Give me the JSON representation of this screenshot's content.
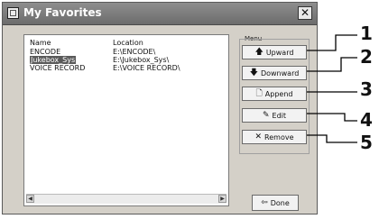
{
  "window": {
    "title": "My Favorites",
    "close_symbol": "✕"
  },
  "list": {
    "columns": [
      "Name",
      "Location"
    ],
    "rows": [
      {
        "name": "ENCODE",
        "location": "E:\\ENCODE\\"
      },
      {
        "name": "Jukebox_Sys",
        "location": "E:\\Jukebox_Sys\\"
      },
      {
        "name": "VOICE RECORD",
        "location": "E:\\VOICE RECORD\\"
      }
    ],
    "selected_row": 1
  },
  "menu": {
    "label": "Menu",
    "buttons": [
      {
        "label": "Upward",
        "icon": "arrow-up-icon"
      },
      {
        "label": "Downward",
        "icon": "arrow-down-icon"
      },
      {
        "label": "Append",
        "icon": "append-icon"
      },
      {
        "label": "Edit",
        "icon": "edit-icon"
      },
      {
        "label": "Remove",
        "icon": "remove-icon"
      }
    ]
  },
  "done": {
    "label": "Done",
    "icon": "exit-door-icon"
  },
  "callouts": [
    "1",
    "2",
    "3",
    "4",
    "5"
  ]
}
